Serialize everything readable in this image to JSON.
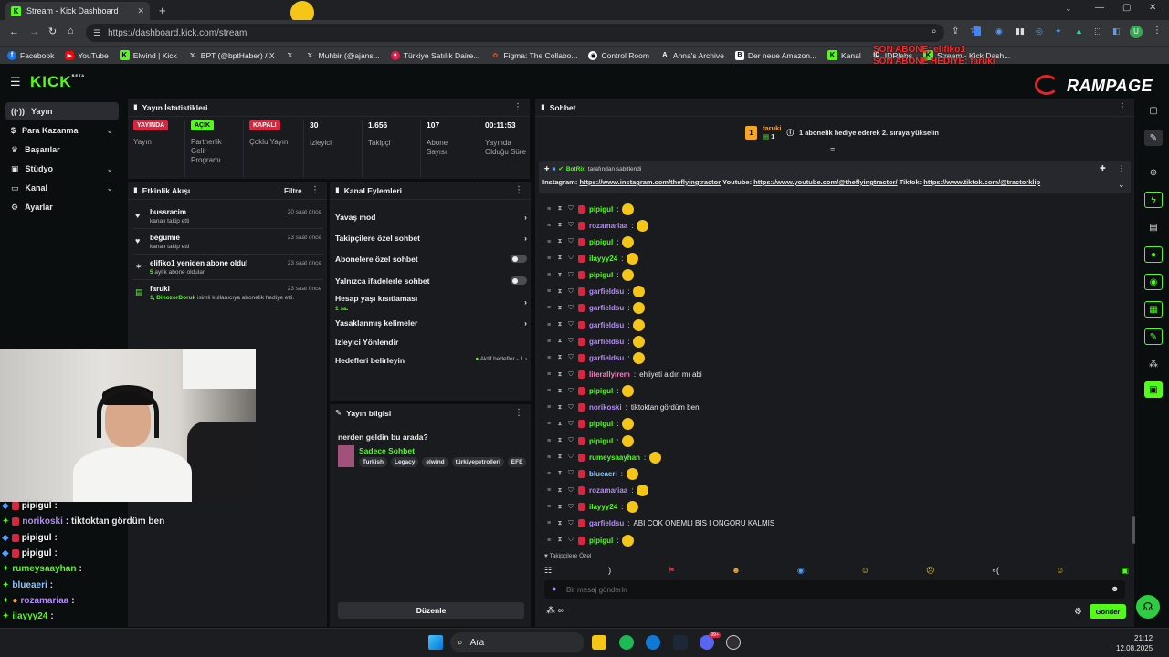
{
  "browser": {
    "tab_title": "Stream - Kick Dashboard",
    "url": "https://dashboard.kick.com/stream",
    "bookmarks": [
      "Facebook",
      "YouTube",
      "Elwind | Kick",
      "BPT (@bptHaber) / X",
      "Muhbir (@ajans...",
      "Türkiye Satılık Daire...",
      "Figma: The Collabo...",
      "Control Room",
      "Anna's Archive",
      "Der neue Amazon...",
      "Kanal",
      "IDRlabs",
      "Stream - Kick Dash..."
    ]
  },
  "overlay_top": {
    "line1": "SON ABONE: elifiko1",
    "line2": "SON ABONE HEDİYE: faruki"
  },
  "header": {
    "logo": "KICK",
    "logo_tag": "BETA",
    "rampage": "RAMPAGE"
  },
  "sidebar": {
    "items": [
      {
        "label": "Yayın",
        "icon": "broadcast-icon"
      },
      {
        "label": "Para Kazanma",
        "icon": "dollar-icon"
      },
      {
        "label": "Başarılar",
        "icon": "trophy-icon"
      },
      {
        "label": "Stüdyo",
        "icon": "studio-icon"
      },
      {
        "label": "Kanal",
        "icon": "channel-icon"
      },
      {
        "label": "Ayarlar",
        "icon": "gear-icon"
      }
    ]
  },
  "stats": {
    "title": "Yayın İstatistikleri",
    "items": [
      {
        "value": "YAYINDA",
        "label": "Yayın"
      },
      {
        "value": "AÇIK",
        "label": "Partnerlik Gelir Programı"
      },
      {
        "value": "KAPALI",
        "label": "Çoklu Yayın"
      },
      {
        "value": "30",
        "label": "İzleyici"
      },
      {
        "value": "1.656",
        "label": "Takipçi"
      },
      {
        "value": "107",
        "label": "Abone Sayısı"
      },
      {
        "value": "00:11:53",
        "label": "Yayında Olduğu Süre"
      }
    ],
    "colors": {
      "live": "#d7263d",
      "on": "#53fc18",
      "off": "#d7263d"
    }
  },
  "activity": {
    "title": "Etkinlik Akışı",
    "filter": "Filtre",
    "items": [
      {
        "name": "bussracim",
        "sub": "kanalı takip etti",
        "time": "20 saat önce",
        "icon": "heart-icon"
      },
      {
        "name": "begumie",
        "sub": "kanalı takip etti",
        "time": "23 saat önce",
        "icon": "heart-icon"
      },
      {
        "name": "elifiko1 yeniden abone oldu!",
        "sub_a": "5",
        "sub_b": " aylık abone oldular",
        "time": "23 saat önce",
        "icon": "star-icon"
      },
      {
        "name": "faruki",
        "sub_a": "1, DinozorDoruk",
        "sub_b": " isimli kullanıcıya abonelik hediye etti.",
        "time": "23 saat önce",
        "icon": "gift-icon"
      }
    ]
  },
  "channel_actions": {
    "title": "Kanal Eylemleri",
    "items": [
      {
        "label": "Yavaş mod"
      },
      {
        "label": "Takipçilere özel sohbet"
      },
      {
        "label": "Abonelere özel sohbet"
      },
      {
        "label": "Yalnızca ifadelerle sohbet"
      },
      {
        "label": "Hesap yaşı kısıtlaması",
        "sub": "1 sa."
      },
      {
        "label": "Yasaklanmış kelimeler"
      },
      {
        "label": "İzleyici Yönlendir"
      },
      {
        "label": "Hedefleri belirleyin",
        "extra": "Aktif hedefler - 1"
      }
    ]
  },
  "stream_info": {
    "title": "Yayın bilgisi",
    "stream_title": "nerden geldin bu arada?",
    "category": "Sadece Sohbet",
    "tags": [
      "Turkish",
      "Legacy",
      "elwind",
      "türkiyepetrolleri",
      "EFE"
    ],
    "edit": "Düzenle"
  },
  "chat": {
    "title": "Sohbet",
    "top_user": "faruki",
    "top_count": "1",
    "top_msg": "1 abonelik hediye ederek 2. sıraya yükselin",
    "pinned_by": "BotRix",
    "pinned_suffix": "tarafından sabitlendi",
    "pinned_msg_a": "Instagram: ",
    "pinned_link1": "https://www.instagram.com/theflyingtractor",
    "pinned_msg_b": " Youtube: ",
    "pinned_link2": "https://www.youtube.com/@theflyingtractor/",
    "pinned_msg_c": " Tiktok: ",
    "pinned_link3": "https://www.tiktok.com/@tractorklip",
    "messages": [
      {
        "user": "pipigul",
        "text": "",
        "color": "#53fc18"
      },
      {
        "user": "rozamariaa",
        "text": "",
        "color": "#b48cf7"
      },
      {
        "user": "pipigul",
        "text": "",
        "color": "#53fc18"
      },
      {
        "user": "ilayyy24",
        "text": "",
        "color": "#53fc18"
      },
      {
        "user": "pipigul",
        "text": "",
        "color": "#53fc18"
      },
      {
        "user": "garfieldsu",
        "text": "",
        "color": "#b48cf7"
      },
      {
        "user": "garfieldsu",
        "text": "",
        "color": "#b48cf7"
      },
      {
        "user": "garfieldsu",
        "text": "",
        "color": "#b48cf7"
      },
      {
        "user": "garfieldsu",
        "text": "",
        "color": "#b48cf7"
      },
      {
        "user": "garfieldsu",
        "text": "",
        "color": "#b48cf7"
      },
      {
        "user": "literallyirem",
        "text": "ehliyeti aldın mı abi",
        "color": "#f77fbe"
      },
      {
        "user": "pipigul",
        "text": "",
        "color": "#53fc18"
      },
      {
        "user": "norikoski",
        "text": "tiktoktan gördüm ben",
        "color": "#b48cf7"
      },
      {
        "user": "pipigul",
        "text": "",
        "color": "#53fc18"
      },
      {
        "user": "pipigul",
        "text": "",
        "color": "#53fc18"
      },
      {
        "user": "rumeysaayhan",
        "text": "",
        "color": "#53fc18"
      },
      {
        "user": "blueaeri",
        "text": "",
        "color": "#8cc8ff"
      },
      {
        "user": "rozamariaa",
        "text": "",
        "color": "#b48cf7"
      },
      {
        "user": "ilayyy24",
        "text": "",
        "color": "#53fc18"
      },
      {
        "user": "garfieldsu",
        "text": "ABI COK ONEMLI BIS I ONGORU KALMIS",
        "color": "#b48cf7"
      },
      {
        "user": "pipigul",
        "text": "",
        "color": "#53fc18"
      }
    ],
    "follower_only": "Takipçilere Özel",
    "input_placeholder": "Bir mesaj gönderin",
    "send": "Gönder"
  },
  "overlay_chat": [
    {
      "user": "pipigul",
      "text": ":",
      "color": "#ffffff"
    },
    {
      "user": "norikoski",
      "text": ": tiktoktan gördüm ben",
      "color": "#b48cf7"
    },
    {
      "user": "pipigul",
      "text": ":",
      "color": "#ffffff"
    },
    {
      "user": "pipigul",
      "text": ":",
      "color": "#ffffff"
    },
    {
      "user": "rumeysaayhan",
      "text": ":",
      "color": "#53fc18"
    },
    {
      "user": "blueaeri",
      "text": ":",
      "color": "#8cc8ff"
    },
    {
      "user": "rozamariaa",
      "text": ":",
      "color": "#b48cf7"
    },
    {
      "user": "ilayyy24",
      "text": ":",
      "color": "#53fc18"
    },
    {
      "user": "garfieldsu",
      "text": ": ABI COK ONEMLI BIS I ONGORU KALMIS",
      "color": "#b48cf7"
    },
    {
      "user": "pipigul",
      "text": ":",
      "color": "#ffffff"
    }
  ],
  "taskbar": {
    "search": "Ara",
    "time": "21:12",
    "date": "12.08.2025",
    "badge": "99+"
  }
}
